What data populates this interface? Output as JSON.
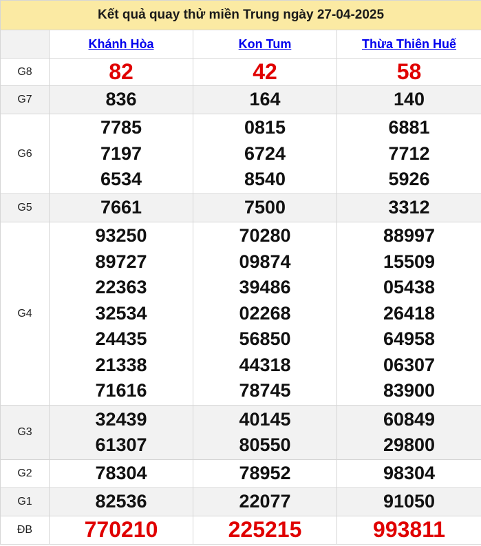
{
  "title": "Kết quả quay thử miền Trung ngày 27-04-2025",
  "provinces": [
    "Khánh Hòa",
    "Kon Tum",
    "Thừa Thiên Huế"
  ],
  "prizes": [
    {
      "label": "G8",
      "values": [
        [
          "82"
        ],
        [
          "42"
        ],
        [
          "58"
        ]
      ]
    },
    {
      "label": "G7",
      "values": [
        [
          "836"
        ],
        [
          "164"
        ],
        [
          "140"
        ]
      ]
    },
    {
      "label": "G6",
      "values": [
        [
          "7785",
          "7197",
          "6534"
        ],
        [
          "0815",
          "6724",
          "8540"
        ],
        [
          "6881",
          "7712",
          "5926"
        ]
      ]
    },
    {
      "label": "G5",
      "values": [
        [
          "7661"
        ],
        [
          "7500"
        ],
        [
          "3312"
        ]
      ]
    },
    {
      "label": "G4",
      "values": [
        [
          "93250",
          "89727",
          "22363",
          "32534",
          "24435",
          "21338",
          "71616"
        ],
        [
          "70280",
          "09874",
          "39486",
          "02268",
          "56850",
          "44318",
          "78745"
        ],
        [
          "88997",
          "15509",
          "05438",
          "26418",
          "64958",
          "06307",
          "83900"
        ]
      ]
    },
    {
      "label": "G3",
      "values": [
        [
          "32439",
          "61307"
        ],
        [
          "40145",
          "80550"
        ],
        [
          "60849",
          "29800"
        ]
      ]
    },
    {
      "label": "G2",
      "values": [
        [
          "78304"
        ],
        [
          "78952"
        ],
        [
          "98304"
        ]
      ]
    },
    {
      "label": "G1",
      "values": [
        [
          "82536"
        ],
        [
          "22077"
        ],
        [
          "91050"
        ]
      ]
    },
    {
      "label": "ĐB",
      "values": [
        [
          "770210"
        ],
        [
          "225215"
        ],
        [
          "993811"
        ]
      ]
    }
  ],
  "colors": {
    "title_bg": "#fbeaa3",
    "link": "#0000ee",
    "special_red": "#e00000"
  }
}
